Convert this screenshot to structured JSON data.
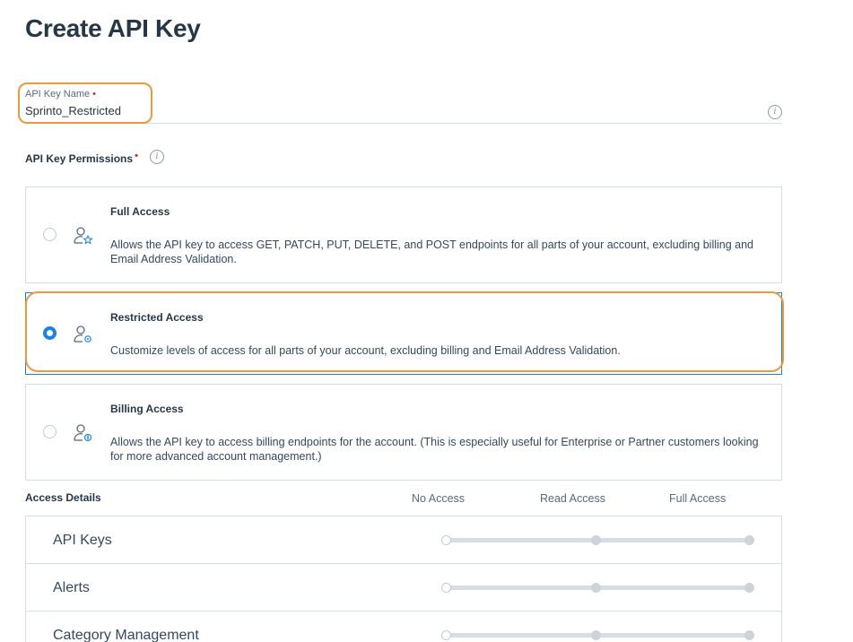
{
  "page": {
    "title": "Create API Key"
  },
  "name_field": {
    "label": "API Key Name",
    "required_marker": "•",
    "value": "Sprinto_Restricted",
    "info_glyph": "i"
  },
  "permissions": {
    "label": "API Key Permissions",
    "required_marker": "•",
    "info_glyph": "i",
    "selected": "restricted",
    "options": [
      {
        "id": "full",
        "title": "Full Access",
        "description": "Allows the API key to access GET, PATCH, PUT, DELETE, and POST endpoints for all parts of your account, excluding billing and Email Address Validation.",
        "icon": "user-star-icon"
      },
      {
        "id": "restricted",
        "title": "Restricted Access",
        "description": "Customize levels of access for all parts of your account, excluding billing and Email Address Validation.",
        "icon": "user-gear-icon"
      },
      {
        "id": "billing",
        "title": "Billing Access",
        "description": "Allows the API key to access billing endpoints for the account. (This is especially useful for Enterprise or Partner customers looking for more advanced account management.)",
        "icon": "user-dollar-icon"
      }
    ]
  },
  "access_details": {
    "header": "Access Details",
    "columns": {
      "no": "No Access",
      "read": "Read Access",
      "full": "Full Access"
    },
    "rows": [
      {
        "label": "API Keys",
        "level": "No Access"
      },
      {
        "label": "Alerts",
        "level": "No Access"
      },
      {
        "label": "Category Management",
        "level": "No Access"
      }
    ]
  },
  "colors": {
    "accent": "#1a82e2",
    "highlight": "#e99a3a",
    "required": "#c8302b",
    "text": "#263746"
  }
}
